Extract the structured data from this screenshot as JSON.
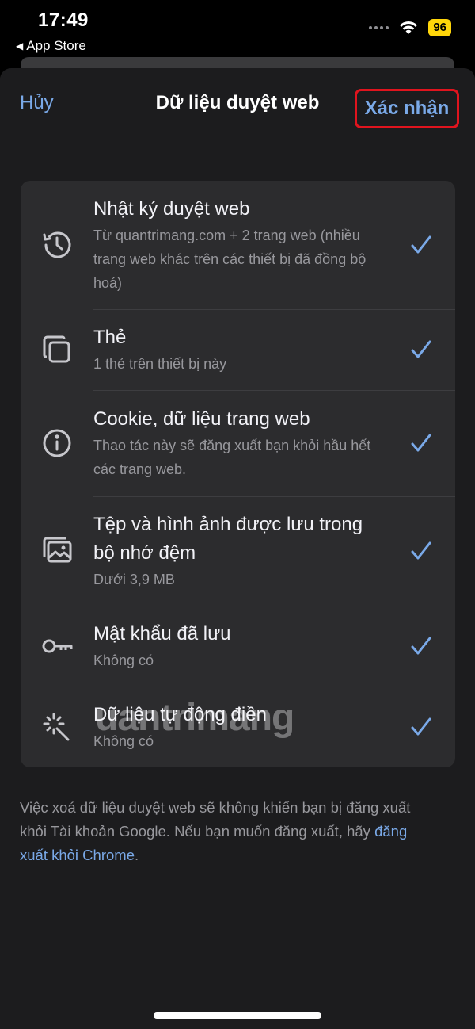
{
  "status": {
    "time": "17:49",
    "back_app": "App Store",
    "battery": "96"
  },
  "nav": {
    "cancel": "Hủy",
    "title": "Dữ liệu duyệt web",
    "confirm": "Xác nhận"
  },
  "items": [
    {
      "icon": "history-icon",
      "title": "Nhật ký duyệt web",
      "subtitle": "Từ quantrimang.com + 2 trang web (nhiều trang web khác trên các thiết bị đã đồng bộ hoá)",
      "checked": true
    },
    {
      "icon": "tabs-icon",
      "title": "Thẻ",
      "subtitle": "1 thẻ trên thiết bị này",
      "checked": true
    },
    {
      "icon": "info-icon",
      "title": "Cookie, dữ liệu trang web",
      "subtitle": "Thao tác này sẽ đăng xuất bạn khỏi hầu hết các trang web.",
      "checked": true
    },
    {
      "icon": "images-icon",
      "title": "Tệp và hình ảnh được lưu trong bộ nhớ đệm",
      "subtitle": "Dưới 3,9 MB",
      "checked": true
    },
    {
      "icon": "key-icon",
      "title": "Mật khẩu đã lưu",
      "subtitle": "Không có",
      "checked": true
    },
    {
      "icon": "autofill-wand-icon",
      "title": "Dữ liệu tự động điền",
      "subtitle": "Không có",
      "checked": true
    }
  ],
  "footer": {
    "text": "Việc xoá dữ liệu duyệt web sẽ không khiến bạn bị đăng xuất khỏi Tài khoản Google. Nếu bạn muốn đăng xuất, hãy ",
    "link": "đăng xuất khỏi Chrome",
    "end": "."
  },
  "watermark": "uantrimang",
  "colors": {
    "accent": "#7aa9e8",
    "highlight_border": "#e0141e",
    "battery": "#ffd60a"
  }
}
